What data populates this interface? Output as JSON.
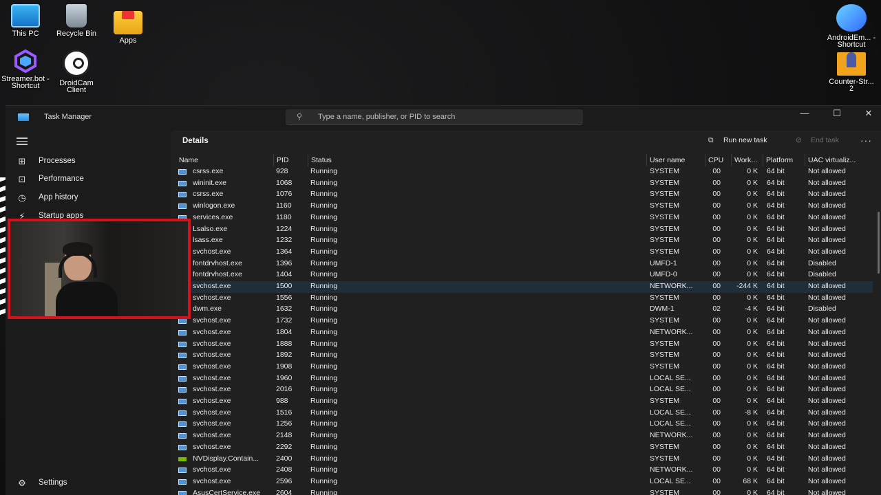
{
  "desktop": {
    "icons": [
      {
        "label": "This PC",
        "icon": "monitor-icon"
      },
      {
        "label": "Recycle Bin",
        "icon": "recycle-bin-icon"
      },
      {
        "label": "Apps",
        "icon": "folder-icon"
      },
      {
        "label": "Streamer.bot - Shortcut",
        "icon": "streamerbot-icon"
      },
      {
        "label": "DroidCam Client",
        "icon": "droidcam-icon"
      },
      {
        "label": "AndroidEm... - Shortcut",
        "icon": "android-emulator-icon"
      },
      {
        "label": "Counter-Str... 2",
        "icon": "counter-strike-icon"
      }
    ]
  },
  "window": {
    "title": "Task Manager",
    "search_placeholder": "Type a name, publisher, or PID to search",
    "controls": {
      "minimize": "—",
      "maximize": "☐",
      "close": "✕"
    }
  },
  "sidebar": {
    "items": [
      {
        "label": "Processes",
        "icon": "processes-icon",
        "glyph": "⊞"
      },
      {
        "label": "Performance",
        "icon": "performance-icon",
        "glyph": "⊡"
      },
      {
        "label": "App history",
        "icon": "history-icon",
        "glyph": "◷"
      },
      {
        "label": "Startup apps",
        "icon": "startup-icon",
        "glyph": "⚡"
      }
    ],
    "settings_label": "Settings"
  },
  "main": {
    "title": "Details",
    "run_new_task": "Run new task",
    "end_task": "End task",
    "more": "···"
  },
  "table": {
    "columns": [
      "Name",
      "PID",
      "Status",
      "User name",
      "CPU",
      "Work...",
      "Platform",
      "UAC virtualiz..."
    ],
    "rows": [
      [
        "csrss.exe",
        "928",
        "Running",
        "SYSTEM",
        "00",
        "0 K",
        "64 bit",
        "Not allowed"
      ],
      [
        "wininit.exe",
        "1068",
        "Running",
        "SYSTEM",
        "00",
        "0 K",
        "64 bit",
        "Not allowed"
      ],
      [
        "csrss.exe",
        "1076",
        "Running",
        "SYSTEM",
        "00",
        "0 K",
        "64 bit",
        "Not allowed"
      ],
      [
        "winlogon.exe",
        "1160",
        "Running",
        "SYSTEM",
        "00",
        "0 K",
        "64 bit",
        "Not allowed"
      ],
      [
        "services.exe",
        "1180",
        "Running",
        "SYSTEM",
        "00",
        "0 K",
        "64 bit",
        "Not allowed"
      ],
      [
        "Lsalso.exe",
        "1224",
        "Running",
        "SYSTEM",
        "00",
        "0 K",
        "64 bit",
        "Not allowed"
      ],
      [
        "lsass.exe",
        "1232",
        "Running",
        "SYSTEM",
        "00",
        "0 K",
        "64 bit",
        "Not allowed"
      ],
      [
        "svchost.exe",
        "1364",
        "Running",
        "SYSTEM",
        "00",
        "0 K",
        "64 bit",
        "Not allowed"
      ],
      [
        "fontdrvhost.exe",
        "1396",
        "Running",
        "UMFD-1",
        "00",
        "0 K",
        "64 bit",
        "Disabled"
      ],
      [
        "fontdrvhost.exe",
        "1404",
        "Running",
        "UMFD-0",
        "00",
        "0 K",
        "64 bit",
        "Disabled"
      ],
      [
        "svchost.exe",
        "1500",
        "Running",
        "NETWORK...",
        "00",
        "-244 K",
        "64 bit",
        "Not allowed"
      ],
      [
        "svchost.exe",
        "1556",
        "Running",
        "SYSTEM",
        "00",
        "0 K",
        "64 bit",
        "Not allowed"
      ],
      [
        "dwm.exe",
        "1632",
        "Running",
        "DWM-1",
        "02",
        "-4 K",
        "64 bit",
        "Disabled"
      ],
      [
        "svchost.exe",
        "1732",
        "Running",
        "SYSTEM",
        "00",
        "0 K",
        "64 bit",
        "Not allowed"
      ],
      [
        "svchost.exe",
        "1804",
        "Running",
        "NETWORK...",
        "00",
        "0 K",
        "64 bit",
        "Not allowed"
      ],
      [
        "svchost.exe",
        "1888",
        "Running",
        "SYSTEM",
        "00",
        "0 K",
        "64 bit",
        "Not allowed"
      ],
      [
        "svchost.exe",
        "1892",
        "Running",
        "SYSTEM",
        "00",
        "0 K",
        "64 bit",
        "Not allowed"
      ],
      [
        "svchost.exe",
        "1908",
        "Running",
        "SYSTEM",
        "00",
        "0 K",
        "64 bit",
        "Not allowed"
      ],
      [
        "svchost.exe",
        "1960",
        "Running",
        "LOCAL SE...",
        "00",
        "0 K",
        "64 bit",
        "Not allowed"
      ],
      [
        "svchost.exe",
        "2016",
        "Running",
        "LOCAL SE...",
        "00",
        "0 K",
        "64 bit",
        "Not allowed"
      ],
      [
        "svchost.exe",
        "988",
        "Running",
        "SYSTEM",
        "00",
        "0 K",
        "64 bit",
        "Not allowed"
      ],
      [
        "svchost.exe",
        "1516",
        "Running",
        "LOCAL SE...",
        "00",
        "-8 K",
        "64 bit",
        "Not allowed"
      ],
      [
        "svchost.exe",
        "1256",
        "Running",
        "LOCAL SE...",
        "00",
        "0 K",
        "64 bit",
        "Not allowed"
      ],
      [
        "svchost.exe",
        "2148",
        "Running",
        "NETWORK...",
        "00",
        "0 K",
        "64 bit",
        "Not allowed"
      ],
      [
        "svchost.exe",
        "2292",
        "Running",
        "SYSTEM",
        "00",
        "0 K",
        "64 bit",
        "Not allowed"
      ],
      [
        "NVDisplay.Contain...",
        "2400",
        "Running",
        "SYSTEM",
        "00",
        "0 K",
        "64 bit",
        "Not allowed"
      ],
      [
        "svchost.exe",
        "2408",
        "Running",
        "NETWORK...",
        "00",
        "0 K",
        "64 bit",
        "Not allowed"
      ],
      [
        "svchost.exe",
        "2596",
        "Running",
        "LOCAL SE...",
        "00",
        "68 K",
        "64 bit",
        "Not allowed"
      ],
      [
        "AsusCertService.exe",
        "2604",
        "Running",
        "SYSTEM",
        "00",
        "0 K",
        "64 bit",
        "Not allowed"
      ]
    ],
    "highlighted_row": 10
  }
}
